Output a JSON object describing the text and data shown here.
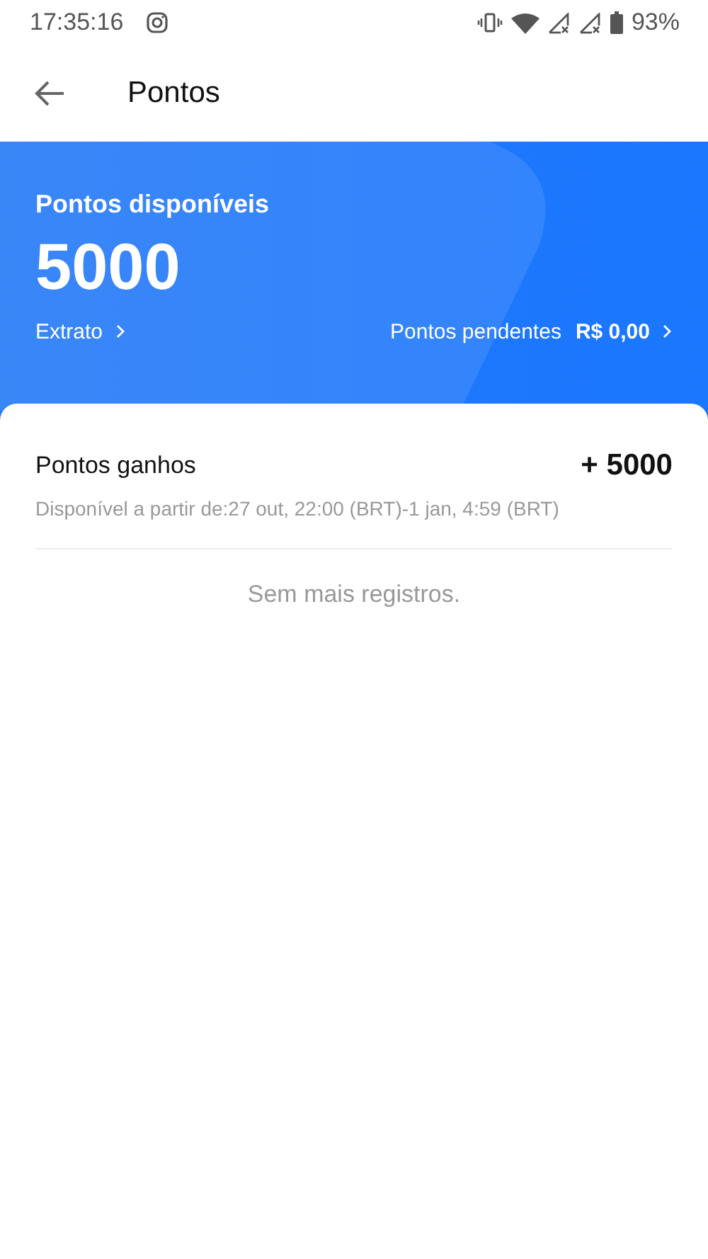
{
  "status_bar": {
    "time": "17:35:16",
    "battery": "93%"
  },
  "header": {
    "title": "Pontos"
  },
  "summary": {
    "label": "Pontos disponíveis",
    "points": "5000",
    "statement_link": "Extrato",
    "pending_label": "Pontos pendentes",
    "pending_value": "R$ 0,00"
  },
  "records": [
    {
      "title": "Pontos ganhos",
      "amount": "+ 5000",
      "detail": "Disponível a partir de:27 out, 22:00 (BRT)-1 jan, 4:59 (BRT)"
    }
  ],
  "end_message": "Sem mais registros."
}
